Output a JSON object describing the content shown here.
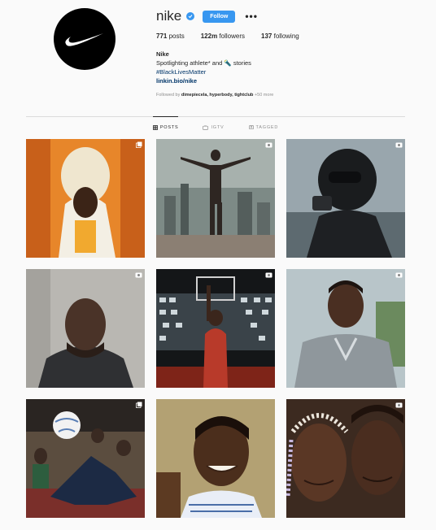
{
  "profile": {
    "username": "nike",
    "follow_label": "Follow",
    "more_label": "•••",
    "stats": [
      {
        "count": "771",
        "label": "posts"
      },
      {
        "count": "122m",
        "label": "followers"
      },
      {
        "count": "137",
        "label": "following"
      }
    ],
    "bio": {
      "name": "Nike",
      "line1": "Spotlighting athlete* and 🔦 stories",
      "hashtag": "#BlackLivesMatter",
      "link": "linkin.bio/nike"
    },
    "followed_by_prefix": "Followed by",
    "followed_by_names": "dimepiecela, hyperbody, tightclub",
    "followed_by_more": "+50 more"
  },
  "tabs": [
    {
      "label": "POSTS",
      "icon": "grid-icon",
      "active": true
    },
    {
      "label": "IGTV",
      "icon": "tv-icon",
      "active": false
    },
    {
      "label": "TAGGED",
      "icon": "tag-icon",
      "active": false
    }
  ],
  "posts": [
    {
      "type": "carousel",
      "type_icon": "carousel-icon"
    },
    {
      "type": "video",
      "type_icon": "video-icon"
    },
    {
      "type": "video",
      "type_icon": "video-icon"
    },
    {
      "type": "video",
      "type_icon": "video-icon"
    },
    {
      "type": "video",
      "type_icon": "video-icon"
    },
    {
      "type": "video",
      "type_icon": "video-icon"
    },
    {
      "type": "carousel",
      "type_icon": "carousel-icon"
    },
    {
      "type": "none",
      "type_icon": ""
    },
    {
      "type": "video",
      "type_icon": "video-icon"
    }
  ],
  "colors": {
    "accent": "#3897f0",
    "text": "#262626",
    "muted": "#8e8e8e",
    "link": "#003569",
    "background": "#fafafa"
  }
}
